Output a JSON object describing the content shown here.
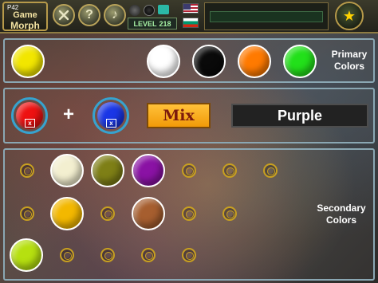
{
  "header": {
    "logo_small": "P42",
    "logo_line1": "Game",
    "logo_line2": "Morph",
    "level_label": "LEVEL",
    "level_number": "218",
    "progress_fraction": 0.0,
    "icons": [
      "tools-icon",
      "help-icon",
      "music-icon",
      "star-icon"
    ]
  },
  "primary": {
    "label_line1": "Primary",
    "label_line2": "Colors",
    "selected_color": "#f2e600",
    "colors": [
      "#ffffff",
      "#0a0a0a",
      "#ff7a00",
      "#22e01a"
    ]
  },
  "mix": {
    "left_color": "#ee1111",
    "right_color": "#1a36e6",
    "left_remove_label": "x",
    "right_remove_label": "x",
    "plus": "+",
    "button_label": "Mix",
    "result_text": "Purple"
  },
  "secondary": {
    "label_line1": "Secondary",
    "label_line2": "Colors",
    "found_colors": [
      {
        "name": "cream",
        "color": "#f3efd0"
      },
      {
        "name": "olive",
        "color": "#7e7f16"
      },
      {
        "name": "purple",
        "color": "#8a12a4"
      },
      {
        "name": "amber",
        "color": "#f3b800"
      },
      {
        "name": "brown",
        "color": "#a65e2f"
      },
      {
        "name": "lime",
        "color": "#b6e010"
      }
    ]
  }
}
